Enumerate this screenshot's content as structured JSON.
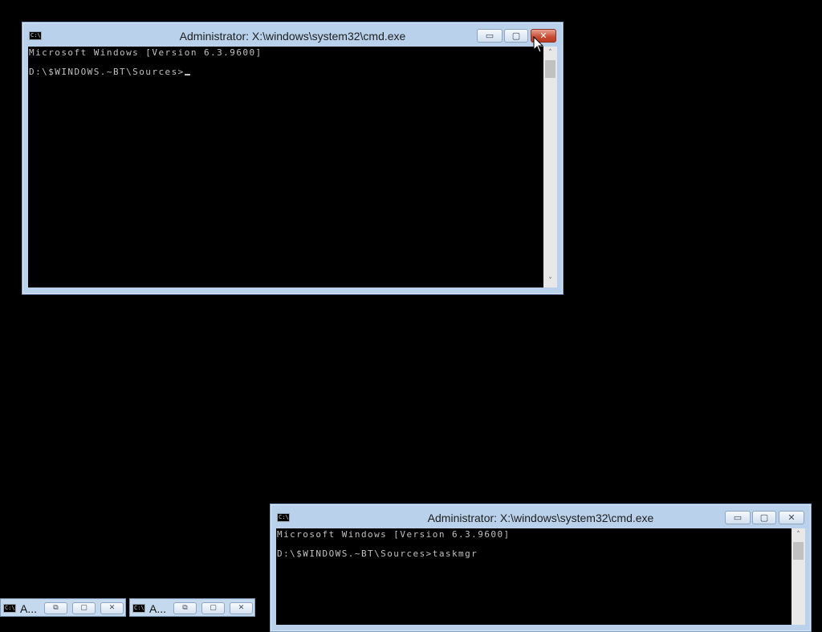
{
  "windows": [
    {
      "title": "Administrator: X:\\windows\\system32\\cmd.exe",
      "icon": "cmd-icon",
      "icon_text": "C:\\.",
      "lines": [
        "Microsoft Windows [Version 6.3.9600]",
        "",
        "D:\\$WINDOWS.~BT\\Sources>"
      ],
      "buttons": {
        "minimize": "▭",
        "maximize": "▢",
        "close": "✕"
      }
    },
    {
      "title": "Administrator: X:\\windows\\system32\\cmd.exe",
      "icon": "cmd-icon",
      "icon_text": "C:\\.",
      "lines": [
        "Microsoft Windows [Version 6.3.9600]",
        "",
        "D:\\$WINDOWS.~BT\\Sources>taskmgr"
      ],
      "buttons": {
        "minimize": "▭",
        "maximize": "▢",
        "close": "✕"
      }
    }
  ],
  "minimized": [
    {
      "label": "A...",
      "icon_text": "C:\\.",
      "restore": "⧉",
      "maximize": "▢",
      "close": "✕"
    },
    {
      "label": "A...",
      "icon_text": "C:\\.",
      "restore": "⧉",
      "maximize": "▢",
      "close": "✕"
    }
  ],
  "scrollbar": {
    "up": "˄",
    "down": "˅"
  }
}
